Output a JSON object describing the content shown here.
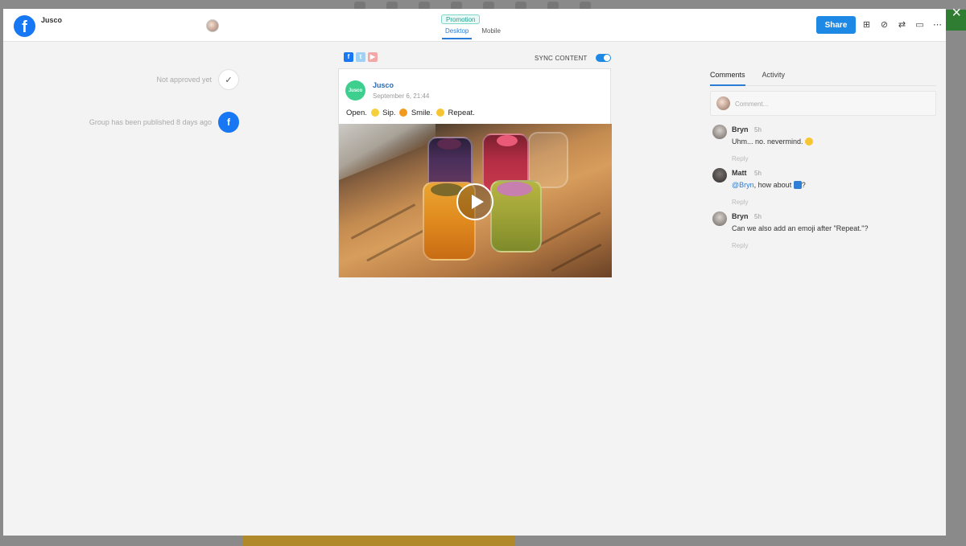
{
  "header": {
    "brand_name": "Jusco",
    "badge": "Promotion",
    "view_tabs": [
      "Desktop",
      "Mobile"
    ],
    "share_label": "Share"
  },
  "status": {
    "approval_text": "Not approved yet",
    "published_text": "Group has been published 8 days ago"
  },
  "editor": {
    "sync_label": "SYNC CONTENT",
    "channels": [
      "facebook",
      "twitter",
      "youtube"
    ]
  },
  "post": {
    "author": "Jusco",
    "date": "September 6, 21:44",
    "avatar_text": "Jusco",
    "text_parts": [
      "Open.",
      "Sip.",
      "Smile.",
      "Repeat."
    ]
  },
  "comments_panel": {
    "tabs": [
      "Comments",
      "Activity"
    ],
    "input_placeholder": "Comment...",
    "comments": [
      {
        "author": "Bryn",
        "time": "5h",
        "text": "Uhm... no. nevermind.",
        "reply": "Reply"
      },
      {
        "author": "Matt",
        "time": "5h",
        "mention": "@Bryn",
        "text": ", how about",
        "suffix": "?",
        "reply": "Reply"
      },
      {
        "author": "Bryn",
        "time": "5h",
        "text": "Can we also add an emoji after \"Repeat.\"?",
        "reply": "Reply"
      }
    ]
  },
  "colors": {
    "accent": "#1e88e5",
    "facebook": "#1877f2",
    "promo_badge": "#2a9d8f"
  },
  "icons": [
    "grid-icon",
    "eye-off-icon",
    "repeat-icon",
    "archive-icon",
    "more-icon",
    "check-icon",
    "facebook-icon",
    "play-icon",
    "close-icon"
  ]
}
